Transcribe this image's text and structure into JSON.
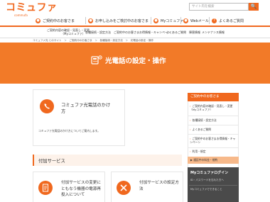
{
  "header": {
    "logo_text": "コミュファ",
    "logo_sub": "commufa",
    "search_placeholder": "サイト内を検索",
    "search_button": "🔍"
  },
  "topnav": [
    {
      "label": "ご契約中のお客さま"
    },
    {
      "label": "お申し込みをご検討中のお客さま"
    },
    {
      "label": "Myコミュファ"
    },
    {
      "label": "Webメール"
    },
    {
      "label": "よくあるご質問"
    }
  ],
  "subnav": [
    {
      "line1": "ご契約内容の確認・見直し・変更",
      "line2": "（Myコミュファ）"
    },
    {
      "line1": "各種接続・設定方法",
      "line2": ""
    },
    {
      "line1": "ご契約中のお客さまお得情報・キャンペーン",
      "line2": ""
    },
    {
      "line1": "よくあるご質問",
      "line2": ""
    },
    {
      "line1": "障害情報",
      "line2": ""
    },
    {
      "line1": "メンテナンス情報",
      "line2": ""
    }
  ],
  "breadcrumb": "コミュファ光 とのサイト　＞　ご契約中のお客さま　＞　各種接続・設定方法　＞　光電話の設定・操作",
  "hero": {
    "title": "光電話の設定・操作"
  },
  "card1": {
    "title": "コミュファ光電話のかけ方",
    "desc": "コミュファ光電話のかけ方についてご案内します。"
  },
  "section": {
    "title": "付加サービス"
  },
  "card2": {
    "title": "付加サービスの変更にともなう機器の電源再投入について"
  },
  "card3": {
    "title": "付加サービスの設定方法"
  },
  "sidebar": {
    "header": "ご契約中のお客さま",
    "items": [
      {
        "label": "ご契約内容の確認・見直し・変更（Myコミュファ）"
      },
      {
        "label": "各種接続・設定方法"
      },
      {
        "label": "よくあるご質問"
      },
      {
        "label": "ご契約中のお客さまお得情報・キャンペーン"
      },
      {
        "label": "利用・規定"
      }
    ],
    "highlight": "▶ 通話中の料金・規約",
    "my": {
      "title": "Myコミュファログイン",
      "line1": "ID・パスワードを忘れた方へ",
      "line2": "Myコミュファでできること"
    }
  },
  "colors": {
    "accent": "#f0681e",
    "hero": "#f27a28"
  }
}
